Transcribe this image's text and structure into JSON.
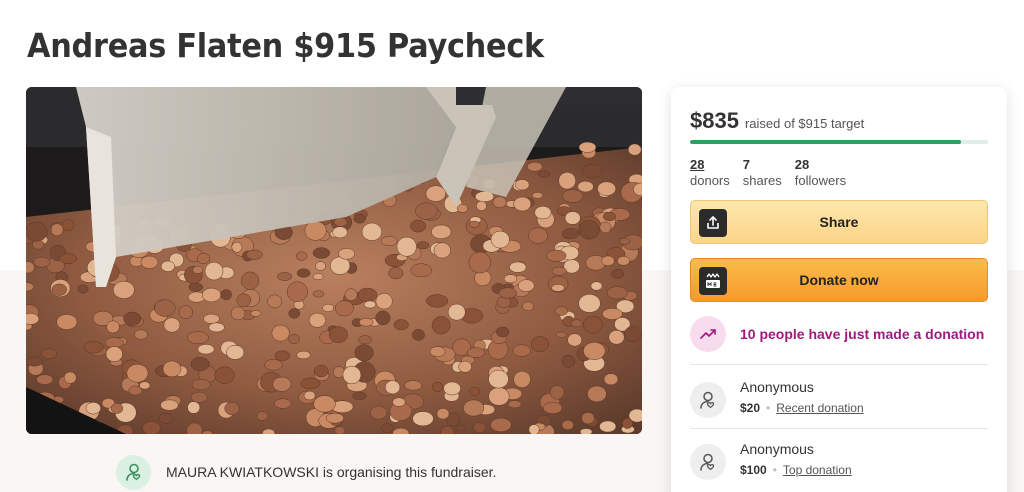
{
  "page": {
    "title": "Andreas Flaten $915 Paycheck"
  },
  "hero": {
    "image_name": "pile-of-pennies-photo"
  },
  "organiser": {
    "text": "MAURA KWIATKOWSKI is organising this fundraiser.",
    "icon": "organiser-person-icon"
  },
  "card": {
    "raised_amount": "$835",
    "raised_of": "raised of $915 target",
    "progress_fraction": 0.91,
    "stats": [
      {
        "value": "28",
        "label": "donors"
      },
      {
        "value": "7",
        "label": "shares"
      },
      {
        "value": "28",
        "label": "followers"
      }
    ],
    "share_label": "Share",
    "donate_label": "Donate now",
    "trend_text": "10 people have just made a donation",
    "donations": [
      {
        "name": "Anonymous",
        "amount": "$20",
        "tag": "Recent donation"
      },
      {
        "name": "Anonymous",
        "amount": "$100",
        "tag": "Top donation"
      }
    ]
  },
  "colors": {
    "progress": "#2f9f62",
    "share_button": "#fbd48b",
    "donate_button": "#f59a2d",
    "trend_text": "#a0197f"
  }
}
